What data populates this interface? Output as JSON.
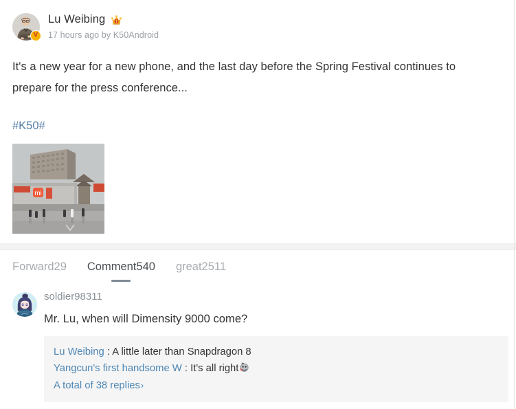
{
  "post": {
    "author": {
      "name": "Lu Weibing",
      "badge_icon": "crown-icon",
      "verified_icon": "verified-v-icon",
      "avatar_icon": "user-avatar"
    },
    "meta": "17 hours ago by K50Android",
    "text": "It's a new year for a new phone, and the last day before the Spring Festival continues to prepare for the press conference...",
    "topic": "#K50#",
    "image_alt": "mi-store-building-photo"
  },
  "tabs": [
    {
      "label": "Forward29",
      "name": "tab-forward",
      "active": false
    },
    {
      "label": "Comment540",
      "name": "tab-comment",
      "active": true
    },
    {
      "label": "great2511",
      "name": "tab-great",
      "active": false
    }
  ],
  "comment": {
    "username": "soldier98311",
    "avatar_icon": "anime-avatar",
    "text": "Mr. Lu, when will Dimensity 9000 come?",
    "replies": [
      {
        "user": "Lu Weibing",
        "separator": " : ",
        "content": "A little later than Snapdragon 8",
        "emoji": ""
      },
      {
        "user": "Yangcun's first handsome W",
        "separator": " : ",
        "content": "It's all right",
        "emoji": "sticker-emoji"
      }
    ],
    "more_replies": "A total of 38 replies",
    "more_chevron": "›"
  },
  "colors": {
    "link": "#4d86b4",
    "topic": "#5680a8",
    "tab_active": "#4a4f54",
    "tab_inactive": "#a7acb1",
    "text": "#333333",
    "muted": "#9aa0a6",
    "reply_bg": "#f5f5f5",
    "badge_yellow": "#f5b301",
    "badge_red": "#d93025"
  }
}
